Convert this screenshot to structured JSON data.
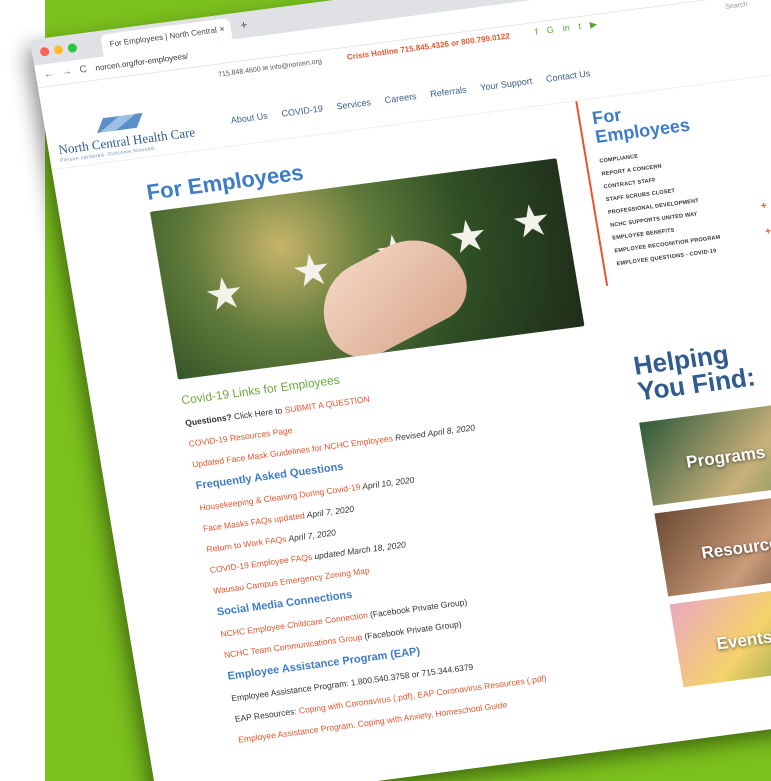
{
  "browser": {
    "tab_title": "For Employees | North Central",
    "url": "norcen.org/for-employees/",
    "new_tab": "+",
    "close_tab": "×",
    "nav": {
      "back": "←",
      "forward": "→",
      "reload": "C",
      "lock": "🔒"
    }
  },
  "topbar": {
    "phone": "715.848.4600",
    "email": "info@norcen.org",
    "hotline_label": "Crisis Hotline",
    "hotline_numbers": "715.845.4326 or 800.799.0122",
    "search": "Search"
  },
  "site": {
    "logo_name": "North Central Health Care",
    "logo_tag": "Person centered. Outcome focused.",
    "menu": [
      "About Us",
      "COVID-19",
      "Services",
      "Careers",
      "Referrals",
      "Your Support",
      "Contact Us"
    ]
  },
  "main": {
    "title": "For Employees",
    "lines": [
      {
        "type": "green",
        "text": "Covid-19 Links for Employees"
      },
      {
        "type": "mixed",
        "bold": "Questions?",
        "plain": " Click Here to ",
        "link": "SUBMIT A QUESTION"
      },
      {
        "type": "link",
        "text": "COVID-19 Resources Page"
      },
      {
        "type": "linkitalic",
        "link": "Updated Face Mask Guidelines for NCHC Employees",
        "italic": " Revised April 8, 2020"
      },
      {
        "type": "blue",
        "text": "Frequently Asked Questions"
      },
      {
        "type": "linkitalic",
        "link": "Housekeeping & Cleaning During Covid-19",
        "italic": " April 10, 2020"
      },
      {
        "type": "linkitalic",
        "link": "Face Masks FAQs updated",
        "italic": " April 7, 2020"
      },
      {
        "type": "linkitalic",
        "link": "Return to Work FAQs",
        "italic": " April 7, 2020"
      },
      {
        "type": "linkitalic",
        "link": "COVID-19 Employee FAQs",
        "italic": " updated March 18, 2020"
      },
      {
        "type": "link",
        "text": "Wausau Campus Emergency Zoning Map"
      },
      {
        "type": "blue",
        "text": "Social Media Connections"
      },
      {
        "type": "linkplain",
        "link": "NCHC Employee Childcare Connection",
        "plain": " (Facebook Private Group)"
      },
      {
        "type": "linkplain",
        "link": "NCHC Team Communications Group",
        "plain": " (Facebook Private Group)"
      },
      {
        "type": "blue",
        "text": "Employee Assistance Program (EAP)"
      },
      {
        "type": "plain",
        "text": "Employee Assistance Program: 1.800.540.3758 or 715.344.6379"
      },
      {
        "type": "linkplain2",
        "plain": "EAP Resources: ",
        "link": "Coping with Coronavirus (.pdf), EAP Coronavirus Resources (.pdf)"
      },
      {
        "type": "link",
        "text": "Employee Assistance Program, Coping with Anxiety, Homeschool Guide"
      }
    ]
  },
  "sidebar": {
    "heading_line1": "For",
    "heading_line2": "Employees",
    "items": [
      {
        "label": "COMPLIANCE",
        "plus": ""
      },
      {
        "label": "REPORT A CONCERN",
        "plus": ""
      },
      {
        "label": "CONTRACT STAFF",
        "plus": ""
      },
      {
        "label": "STAFF SCRUBS CLOSET",
        "plus": ""
      },
      {
        "label": "PROFESSIONAL DEVELOPMENT",
        "plus": ""
      },
      {
        "label": "NCHC SUPPORTS UNITED WAY",
        "plus": "+"
      },
      {
        "label": "EMPLOYEE BENEFITS",
        "plus": ""
      },
      {
        "label": "EMPLOYEE RECOGNITION PROGRAM",
        "plus": "+"
      },
      {
        "label": "EMPLOYEE QUESTIONS - COVID-19",
        "plus": ""
      }
    ],
    "helping_line1": "Helping",
    "helping_line2": "You Find:",
    "tiles": [
      "Programs",
      "Resources",
      "Events"
    ]
  },
  "colors": {
    "accent": "#e4572e",
    "blue": "#3f7cc7",
    "green": "#69ab3a",
    "bg_green": "#7bc11e"
  }
}
